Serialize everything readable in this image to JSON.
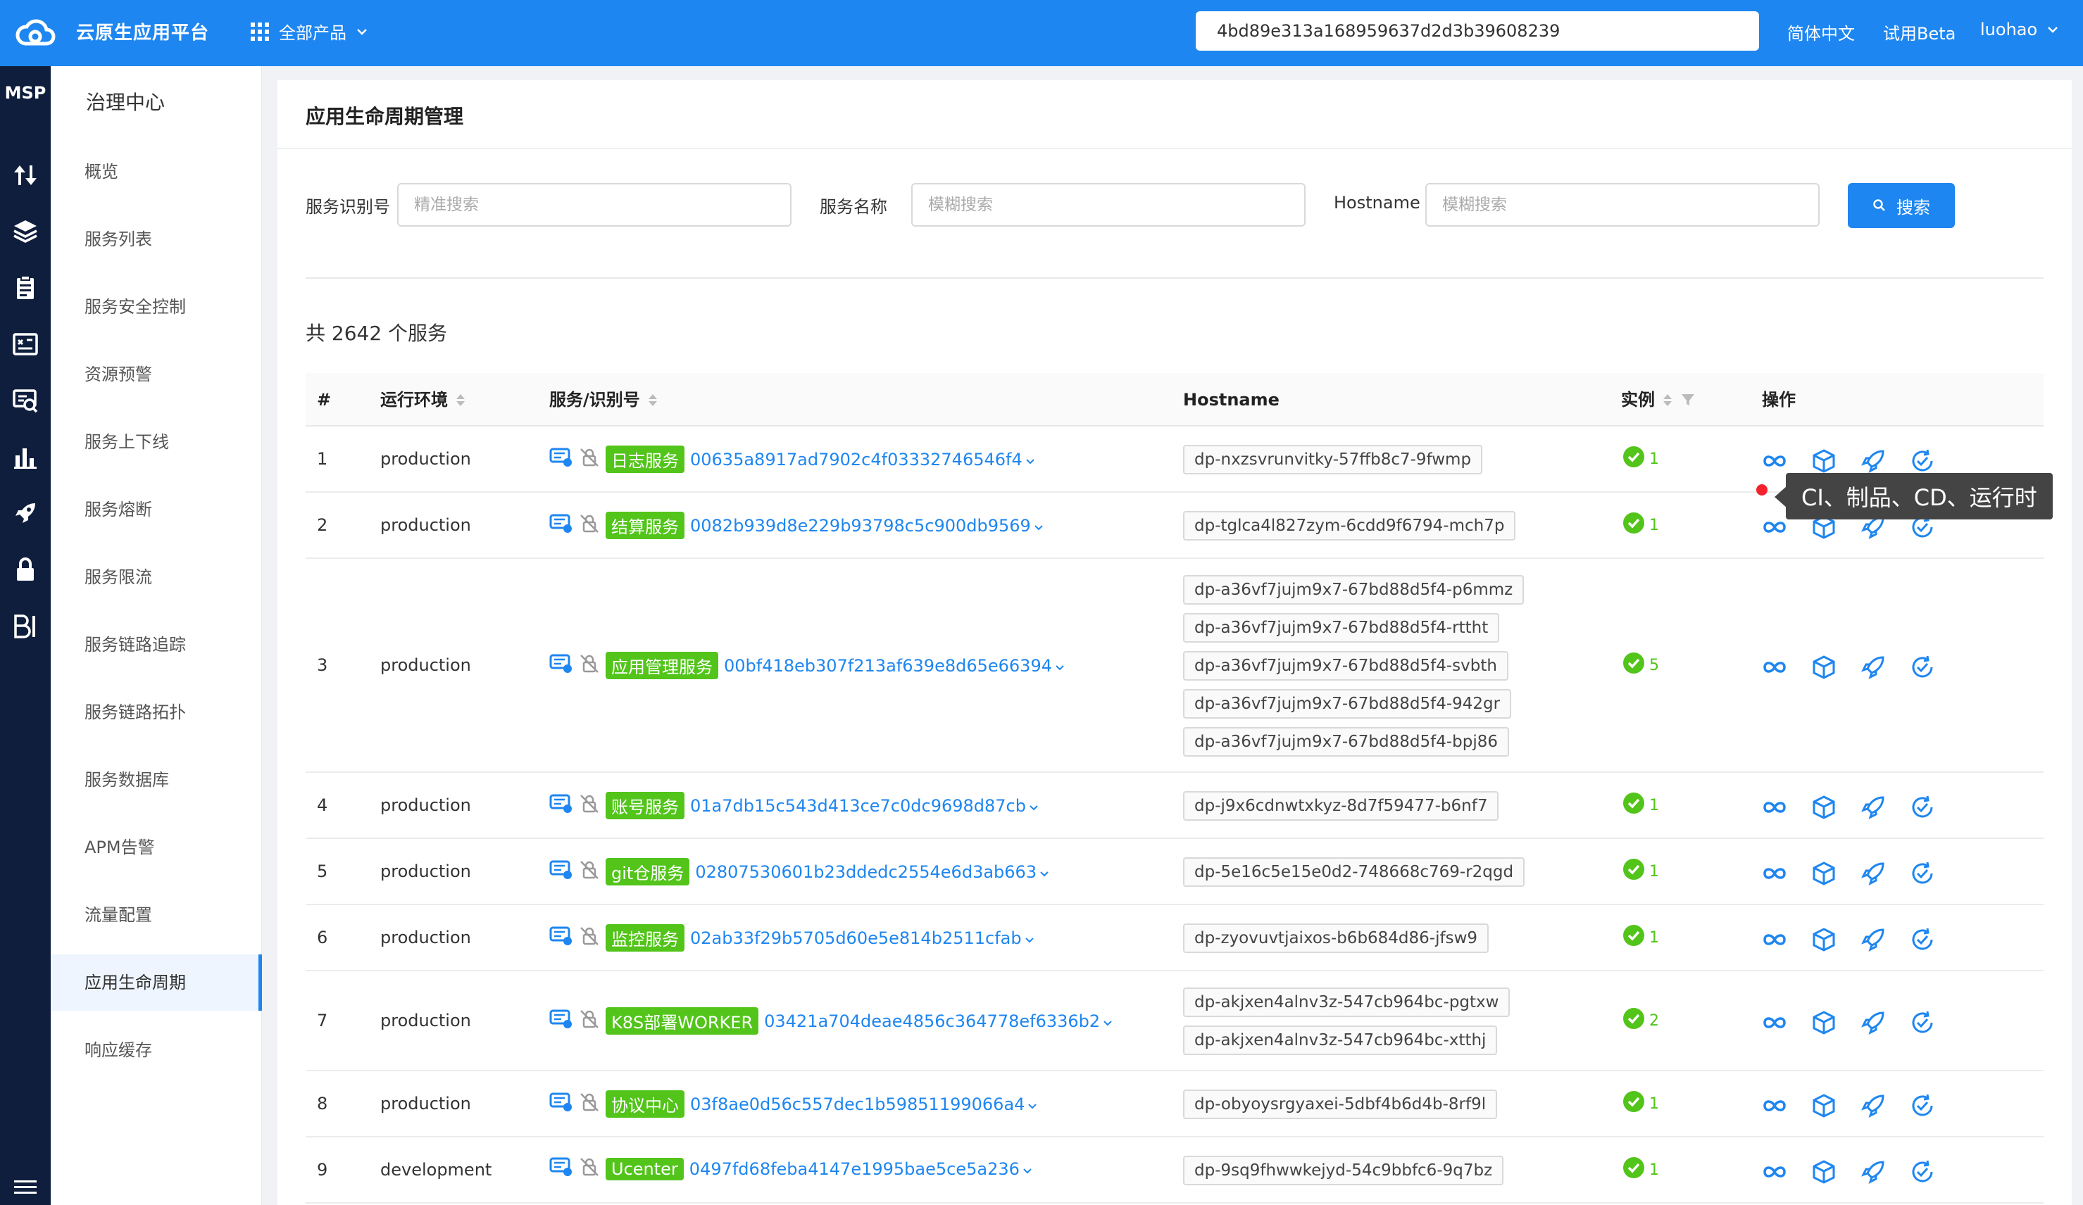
{
  "topbar": {
    "app_title": "云原生应用平台",
    "all_products": "全部产品",
    "search_value": "4bd89e313a168959637d2d3b39608239",
    "language": "简体中文",
    "beta": "试用Beta",
    "user": "luohao"
  },
  "rail": {
    "title": "MSP"
  },
  "sidebar": {
    "title": "治理中心",
    "items": [
      "概览",
      "服务列表",
      "服务安全控制",
      "资源预警",
      "服务上下线",
      "服务熔断",
      "服务限流",
      "服务链路追踪",
      "服务链路拓扑",
      "服务数据库",
      "APM告警",
      "流量配置",
      "应用生命周期",
      "响应缓存"
    ],
    "active_index": 12
  },
  "page": {
    "title": "应用生命周期管理",
    "filters": {
      "service_id_label": "服务识别号",
      "service_id_placeholder": "精准搜索",
      "service_name_label": "服务名称",
      "service_name_placeholder": "模糊搜索",
      "hostname_label": "Hostname",
      "hostname_placeholder": "模糊搜索",
      "search_button": "搜索"
    },
    "summary": "共 2642 个服务"
  },
  "table": {
    "headers": {
      "index": "#",
      "env": "运行环境",
      "service": "服务/识别号",
      "hostname": "Hostname",
      "instances": "实例",
      "ops": "操作"
    },
    "rows": [
      {
        "index": "1",
        "env": "production",
        "tag": "日志服务",
        "id": "00635a8917ad7902c4f03332746546f4",
        "hosts": [
          "dp-nxzsvrunvitky-57ffb8c7-9fwmp"
        ],
        "instances": "1"
      },
      {
        "index": "2",
        "env": "production",
        "tag": "结算服务",
        "id": "0082b939d8e229b93798c5c900db9569",
        "hosts": [
          "dp-tglca4l827zym-6cdd9f6794-mch7p"
        ],
        "instances": "1"
      },
      {
        "index": "3",
        "env": "production",
        "tag": "应用管理服务",
        "id": "00bf418eb307f213af639e8d65e66394",
        "hosts": [
          "dp-a36vf7jujm9x7-67bd88d5f4-p6mmz",
          "dp-a36vf7jujm9x7-67bd88d5f4-rttht",
          "dp-a36vf7jujm9x7-67bd88d5f4-svbth",
          "dp-a36vf7jujm9x7-67bd88d5f4-942gr",
          "dp-a36vf7jujm9x7-67bd88d5f4-bpj86"
        ],
        "instances": "5"
      },
      {
        "index": "4",
        "env": "production",
        "tag": "账号服务",
        "id": "01a7db15c543d413ce7c0dc9698d87cb",
        "hosts": [
          "dp-j9x6cdnwtxkyz-8d7f59477-b6nf7"
        ],
        "instances": "1"
      },
      {
        "index": "5",
        "env": "production",
        "tag": "git仓服务",
        "id": "02807530601b23ddedc2554e6d3ab663",
        "hosts": [
          "dp-5e16c5e15e0d2-748668c769-r2qgd"
        ],
        "instances": "1"
      },
      {
        "index": "6",
        "env": "production",
        "tag": "监控服务",
        "id": "02ab33f29b5705d60e5e814b2511cfab",
        "hosts": [
          "dp-zyovuvtjaixos-b6b684d86-jfsw9"
        ],
        "instances": "1"
      },
      {
        "index": "7",
        "env": "production",
        "tag": "K8S部署WORKER",
        "id": "03421a704deae4856c364778ef6336b2",
        "hosts": [
          "dp-akjxen4alnv3z-547cb964bc-pgtxw",
          "dp-akjxen4alnv3z-547cb964bc-xtthj"
        ],
        "instances": "2"
      },
      {
        "index": "8",
        "env": "production",
        "tag": "协议中心",
        "id": "03f8ae0d56c557dec1b59851199066a4",
        "hosts": [
          "dp-obyoysrgyaxei-5dbf4b6d4b-8rf9l"
        ],
        "instances": "1"
      },
      {
        "index": "9",
        "env": "development",
        "tag": "Ucenter",
        "id": "0497fd68feba4147e1995bae5ce5a236",
        "hosts": [
          "dp-9sq9fhwwkejyd-54c9bbfc6-9q7bz"
        ],
        "instances": "1"
      }
    ]
  },
  "tooltip": "CI、制品、CD、运行时",
  "colors": {
    "primary": "#1e86f0",
    "rail": "#0f1e3c",
    "tag_green": "#52c41a",
    "tooltip_bg": "#444444",
    "alert_red": "#f5222d"
  },
  "icons": {
    "row_status": [
      "monitor-icon",
      "security-lock-icon"
    ],
    "ops": [
      "ci-pipeline-icon",
      "artifact-cube-icon",
      "deploy-rocket-icon",
      "runtime-check-icon"
    ]
  }
}
